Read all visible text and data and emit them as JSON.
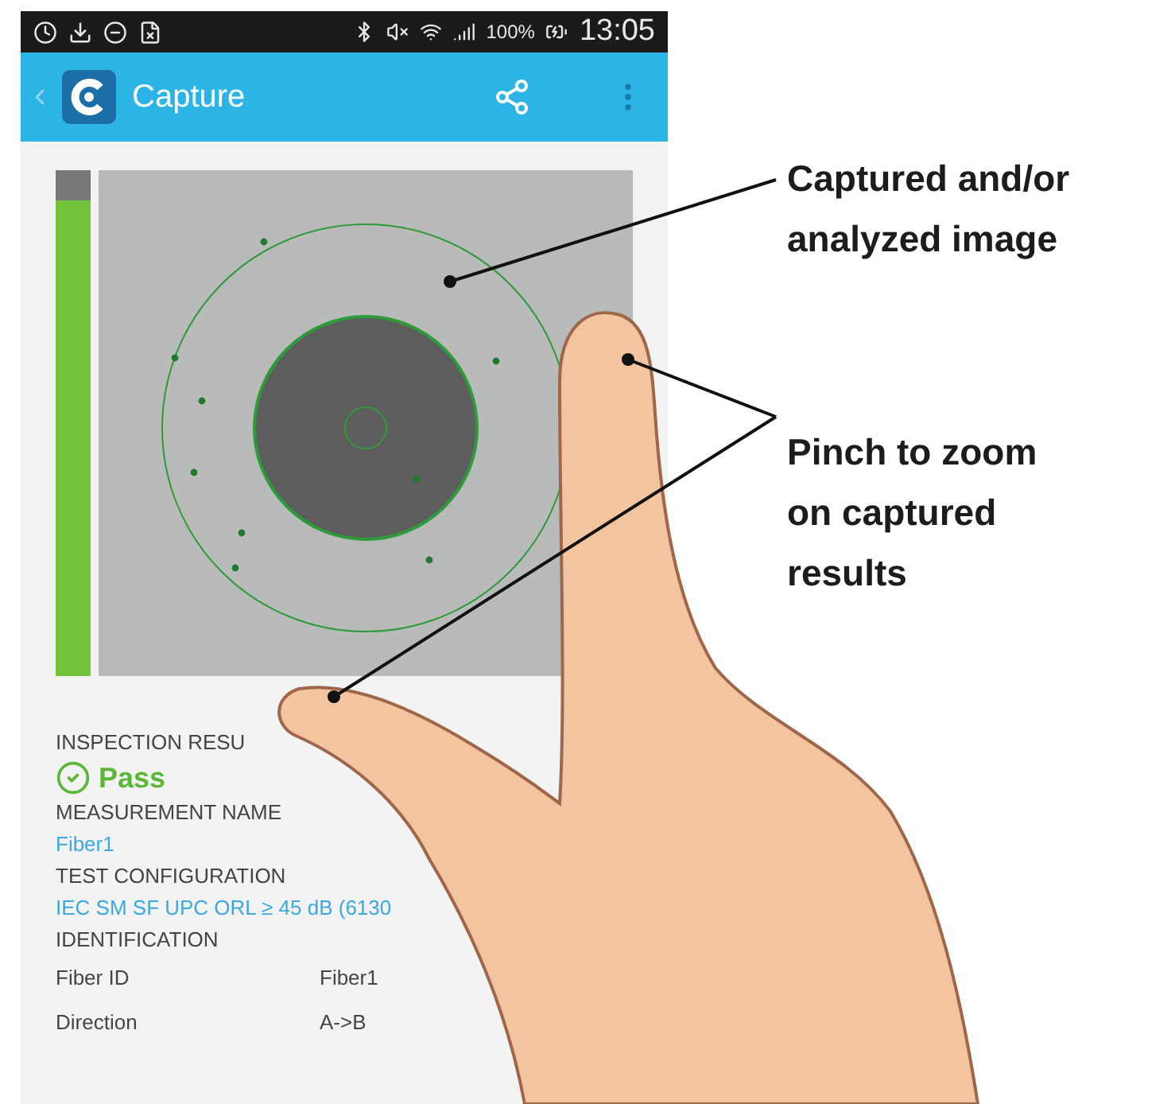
{
  "status_bar": {
    "battery": "100%",
    "time": "13:05"
  },
  "app_bar": {
    "title": "Capture"
  },
  "capture": {
    "level": 0.94
  },
  "details": [
    {
      "kind": "heading",
      "text": "INSPECTION RESU"
    },
    {
      "kind": "result",
      "text": "Pass",
      "passed": true
    },
    {
      "kind": "heading",
      "text": "MEASUREMENT NAME"
    },
    {
      "kind": "value",
      "text": "Fiber1"
    },
    {
      "kind": "heading",
      "text": "TEST CONFIGURATION"
    },
    {
      "kind": "value",
      "text": "IEC SM SF UPC ORL ≥ 45 dB (6130"
    },
    {
      "kind": "heading",
      "text": "IDENTIFICATION"
    },
    {
      "kind": "pair",
      "label": "Fiber ID",
      "text": "Fiber1"
    },
    {
      "kind": "pair",
      "label": "Direction",
      "text": "A->B"
    }
  ],
  "callouts": [
    {
      "lines": [
        "Captured and/or",
        "analyzed image"
      ]
    },
    {
      "lines": [
        "Pinch to zoom",
        "on captured",
        "results"
      ]
    }
  ]
}
